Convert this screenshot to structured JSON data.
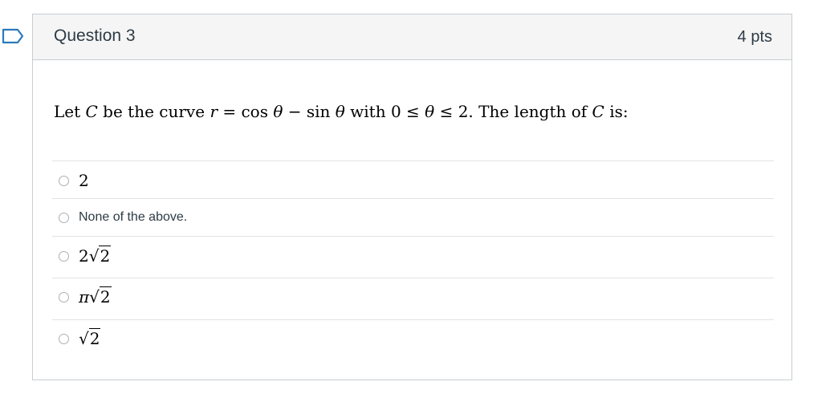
{
  "question": {
    "title": "Question 3",
    "points": "4 pts",
    "prompt_parts": {
      "p1": "Let ",
      "C": "C",
      "p2": " be the curve ",
      "r": "r",
      "eq": " = cos ",
      "theta1": "θ",
      "minus": " − sin ",
      "theta2": "θ",
      "with": " with 0 ≤ ",
      "theta3": "θ",
      "le2": " ≤ 2. The length of ",
      "C2": "C",
      "is": " is:"
    }
  },
  "answers": [
    {
      "label": "2"
    },
    {
      "label": "None of the above."
    },
    {
      "coef": "2",
      "radicand": "2"
    },
    {
      "coef": "π",
      "radicand": "2"
    },
    {
      "coef": "",
      "radicand": "2"
    }
  ],
  "colors": {
    "flag": "#2b7abc",
    "border": "#c7cdd1",
    "header_bg": "#f5f5f5"
  }
}
